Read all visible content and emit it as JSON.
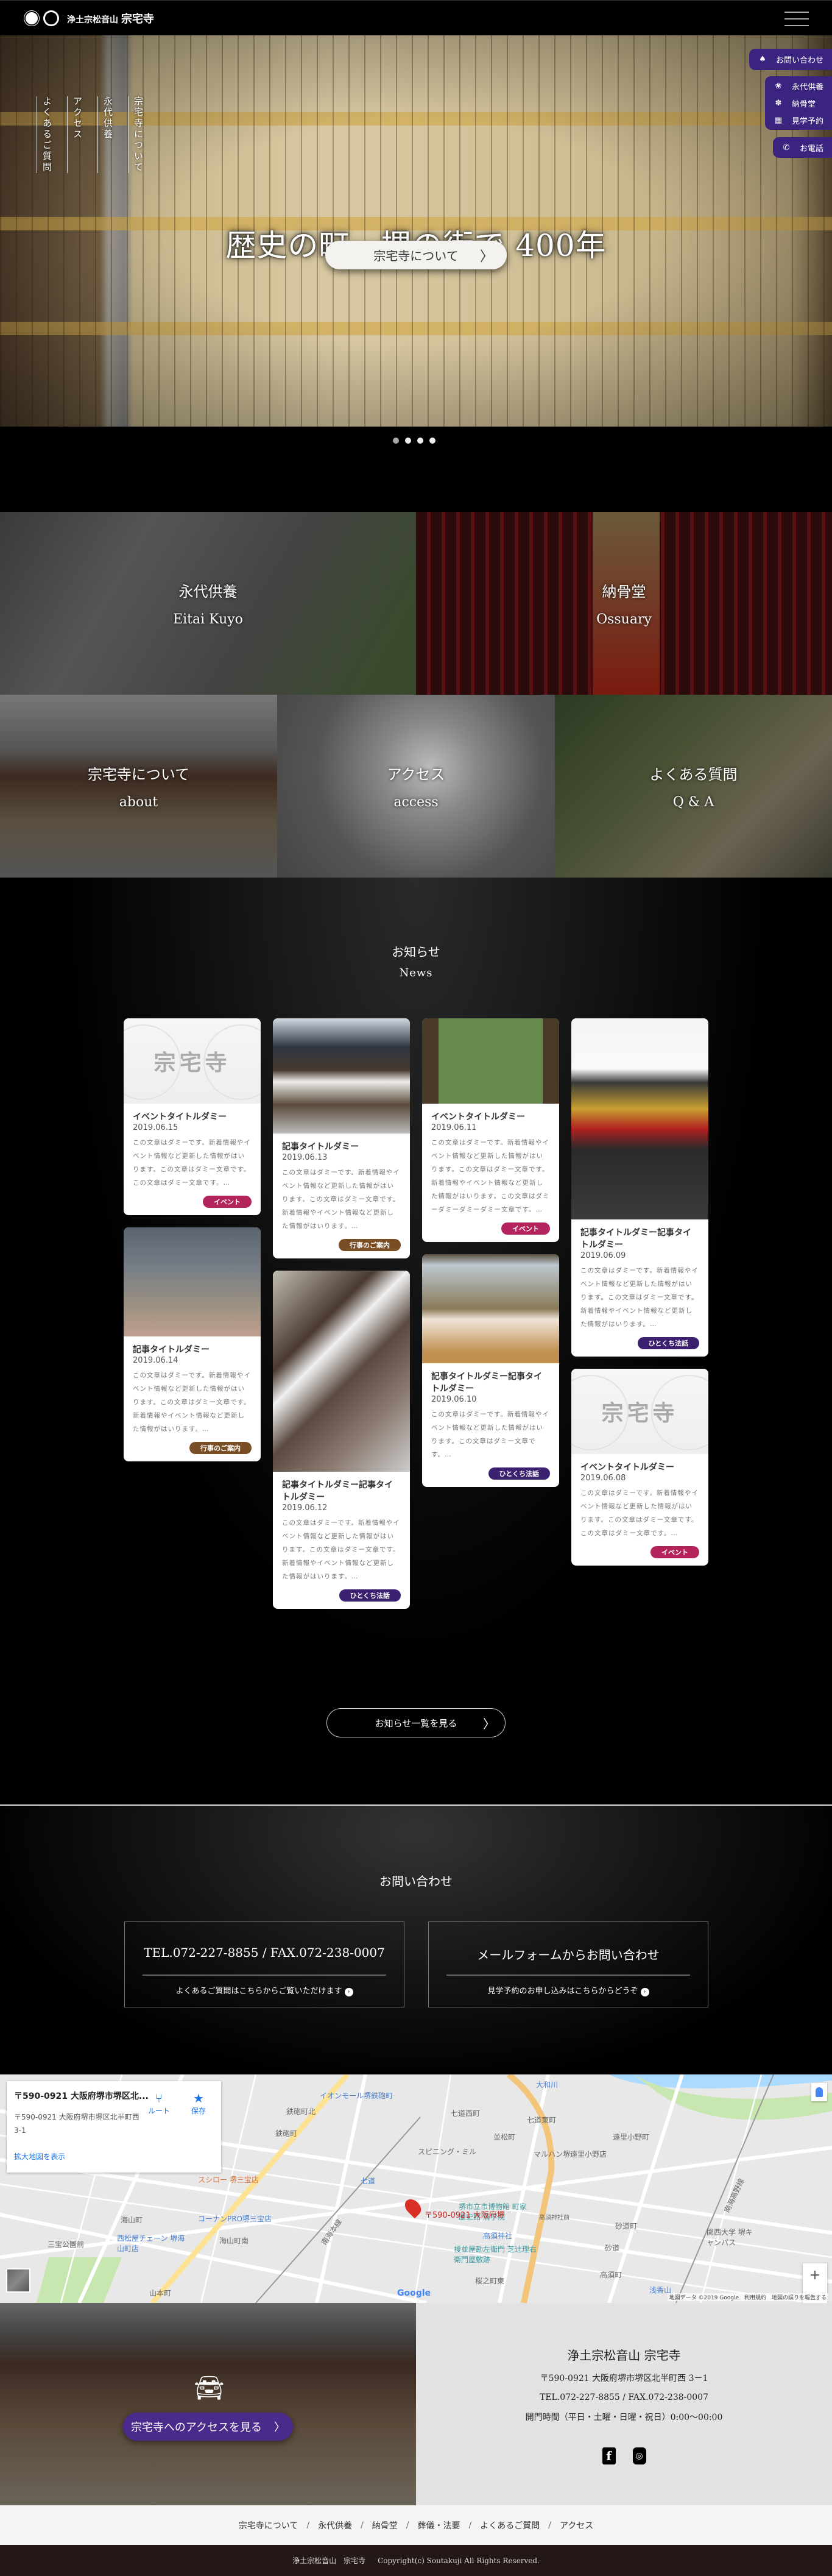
{
  "header": {
    "org": "浄土宗松音山",
    "name": "宗宅寺"
  },
  "hero": {
    "vertical_nav": [
      "宗宅寺について",
      "永代供養",
      "アクセス",
      "よくあるご質問"
    ],
    "title": "歴史の町　堺の街で 400年",
    "button": "宗宅寺について",
    "slide_count": 4,
    "active_slide": 1
  },
  "side_menu": {
    "contact": "お問い合わせ",
    "items": [
      {
        "label": "永代供養",
        "icon": "lotus-icon"
      },
      {
        "label": "納骨堂",
        "icon": "maple-icon"
      },
      {
        "label": "見学予約",
        "icon": "calendar-icon"
      }
    ],
    "phone": "お電話"
  },
  "tiles": [
    {
      "ja": "永代供養",
      "en": "Eitai Kuyo"
    },
    {
      "ja": "納骨堂",
      "en": "Ossuary"
    },
    {
      "ja": "宗宅寺について",
      "en": "about"
    },
    {
      "ja": "アクセス",
      "en": "access"
    },
    {
      "ja": "よくある質問",
      "en": "Q & A"
    }
  ],
  "news": {
    "title": "お知らせ",
    "subtitle": "News",
    "logo_text": "宗宅寺",
    "cards": [
      {
        "title": "イベントタイトルダミー",
        "date": "2019.06.15",
        "text": "この文章はダミーです。新着情報やイベント情報など更新した情報がはいります。この文章はダミー文章です。この文章はダミー文章です。…",
        "tag": "イベント",
        "image": "logo"
      },
      {
        "title": "記事タイトルダミー",
        "date": "2019.06.13",
        "text": "この文章はダミーです。新着情報やイベント情報など更新した情報がはいります。この文章はダミー文章です。新着情報やイベント情報など更新した情報がはいります。…",
        "tag": "行事のご案内",
        "image": "temple-gate"
      },
      {
        "title": "イベントタイトルダミー",
        "date": "2019.06.11",
        "text": "この文章はダミーです。新着情報やイベント情報など更新した情報がはいります。この文章はダミー文章です。新着情報やイベント情報など更新した情報がはいります。この文章はダミーダミーダミーダミー文章です。…",
        "tag": "イベント",
        "image": "garden"
      },
      {
        "title": "記事タイトルダミー記事タイトルダミー",
        "date": "2019.06.09",
        "text": "この文章はダミーです。新着情報やイベント情報など更新した情報がはいります。この文章はダミー文章です。新着情報やイベント情報など更新した情報がはいります。…",
        "tag": "ひとくち法話",
        "image": "hall"
      },
      {
        "title": "記事タイトルダミー",
        "date": "2019.06.14",
        "text": "この文章はダミーです。新着情報やイベント情報など更新した情報がはいります。この文章はダミー文章です。新着情報やイベント情報など更新した情報がはいります。…",
        "tag": "行事のご案内",
        "image": "statues"
      },
      {
        "title": "記事タイトルダミー記事タイトルダミー",
        "date": "2019.06.12",
        "text": "この文章はダミーです。新着情報やイベント情報など更新した情報がはいります。この文章はダミー文章です。新着情報やイベント情報など更新した情報がはいります。…",
        "tag": "ひとくち法話",
        "image": "notice-board"
      },
      {
        "title": "記事タイトルダミー記事タイトルダミー",
        "date": "2019.06.10",
        "text": "この文章はダミーです。新着情報やイベント情報など更新した情報がはいります。この文章はダミー文章です。…",
        "tag": "ひとくち法話",
        "image": "painting"
      },
      {
        "title": "イベントタイトルダミー",
        "date": "2019.06.08",
        "text": "この文章はダミーです。新着情報やイベント情報など更新した情報がはいります。この文章はダミー文章です。この文章はダミー文章です。…",
        "tag": "イベント",
        "image": "logo"
      }
    ],
    "tag_colors": {
      "イベント": "#b3245c",
      "行事のご案内": "#7a4e24",
      "ひとくち法話": "#3b2070"
    },
    "more": "お知らせ一覧を見る"
  },
  "contact": {
    "title": "お問い合わせ",
    "phone_box": {
      "main": "TEL.072-227-8855 / FAX.072-238-0007",
      "sub": "よくあるご質問はこちらからご覧いただけます"
    },
    "mail_box": {
      "main": "メールフォームからお問い合わせ",
      "sub": "見学予約のお申し込みはこちらからどうぞ"
    }
  },
  "map": {
    "card_title": "〒590-0921 大阪府堺市堺区北...",
    "card_address": "〒590-0921 大阪府堺市堺区北半町西 3-1",
    "route": "ルート",
    "save": "保存",
    "larger": "拡大地図を表示",
    "pin_label": "〒590-0921 大阪府堺",
    "labels": [
      "イオンモール堺鉄砲町",
      "鉄砲町北",
      "鉄砲町",
      "スシロー 堺三宝店",
      "コーナンPRO堺三宝店",
      "西松屋チェーン 堺海山町店",
      "海山町",
      "海山町南",
      "三宝公園前",
      "山本町",
      "七道",
      "南海本線",
      "大和川",
      "七道西町",
      "七道東町",
      "並松町",
      "遠里小野町",
      "マルハン堺遠里小野店",
      "スピニング・ミル",
      "堺市立市博物館 町家歴史館 清学院",
      "高須神社前",
      "高須神社",
      "榎並屋勘左衛門 芝辻理右衛門屋敷跡",
      "砂道町",
      "砂道",
      "高須町",
      "関西大学 堺キャンパス",
      "浅香山",
      "南海高野線",
      "桜之町東"
    ],
    "attribution": "地図データ ©2019 Google　利用規約　地図の誤りを報告する",
    "google": "Google"
  },
  "footer": {
    "access_button": "宗宅寺へのアクセスを見る",
    "name": "浄土宗松音山 宗宅寺",
    "address": "〒590-0921 大阪府堺市堺区北半町西 3－1",
    "tel": "TEL.072-227-8855 / FAX.072-238-0007",
    "hours": "開門時間（平日・土曜・日曜・祝日）0:00～00:00",
    "sns": [
      "f",
      "◎"
    ],
    "nav": [
      "宗宅寺について",
      "永代供養",
      "納骨堂",
      "葬儀・法要",
      "よくあるご質問",
      "アクセス"
    ],
    "copyright_org": "浄土宗松音山　宗宅寺",
    "copyright": "Copyright(c) Soutakuji All Rights Reserved."
  }
}
